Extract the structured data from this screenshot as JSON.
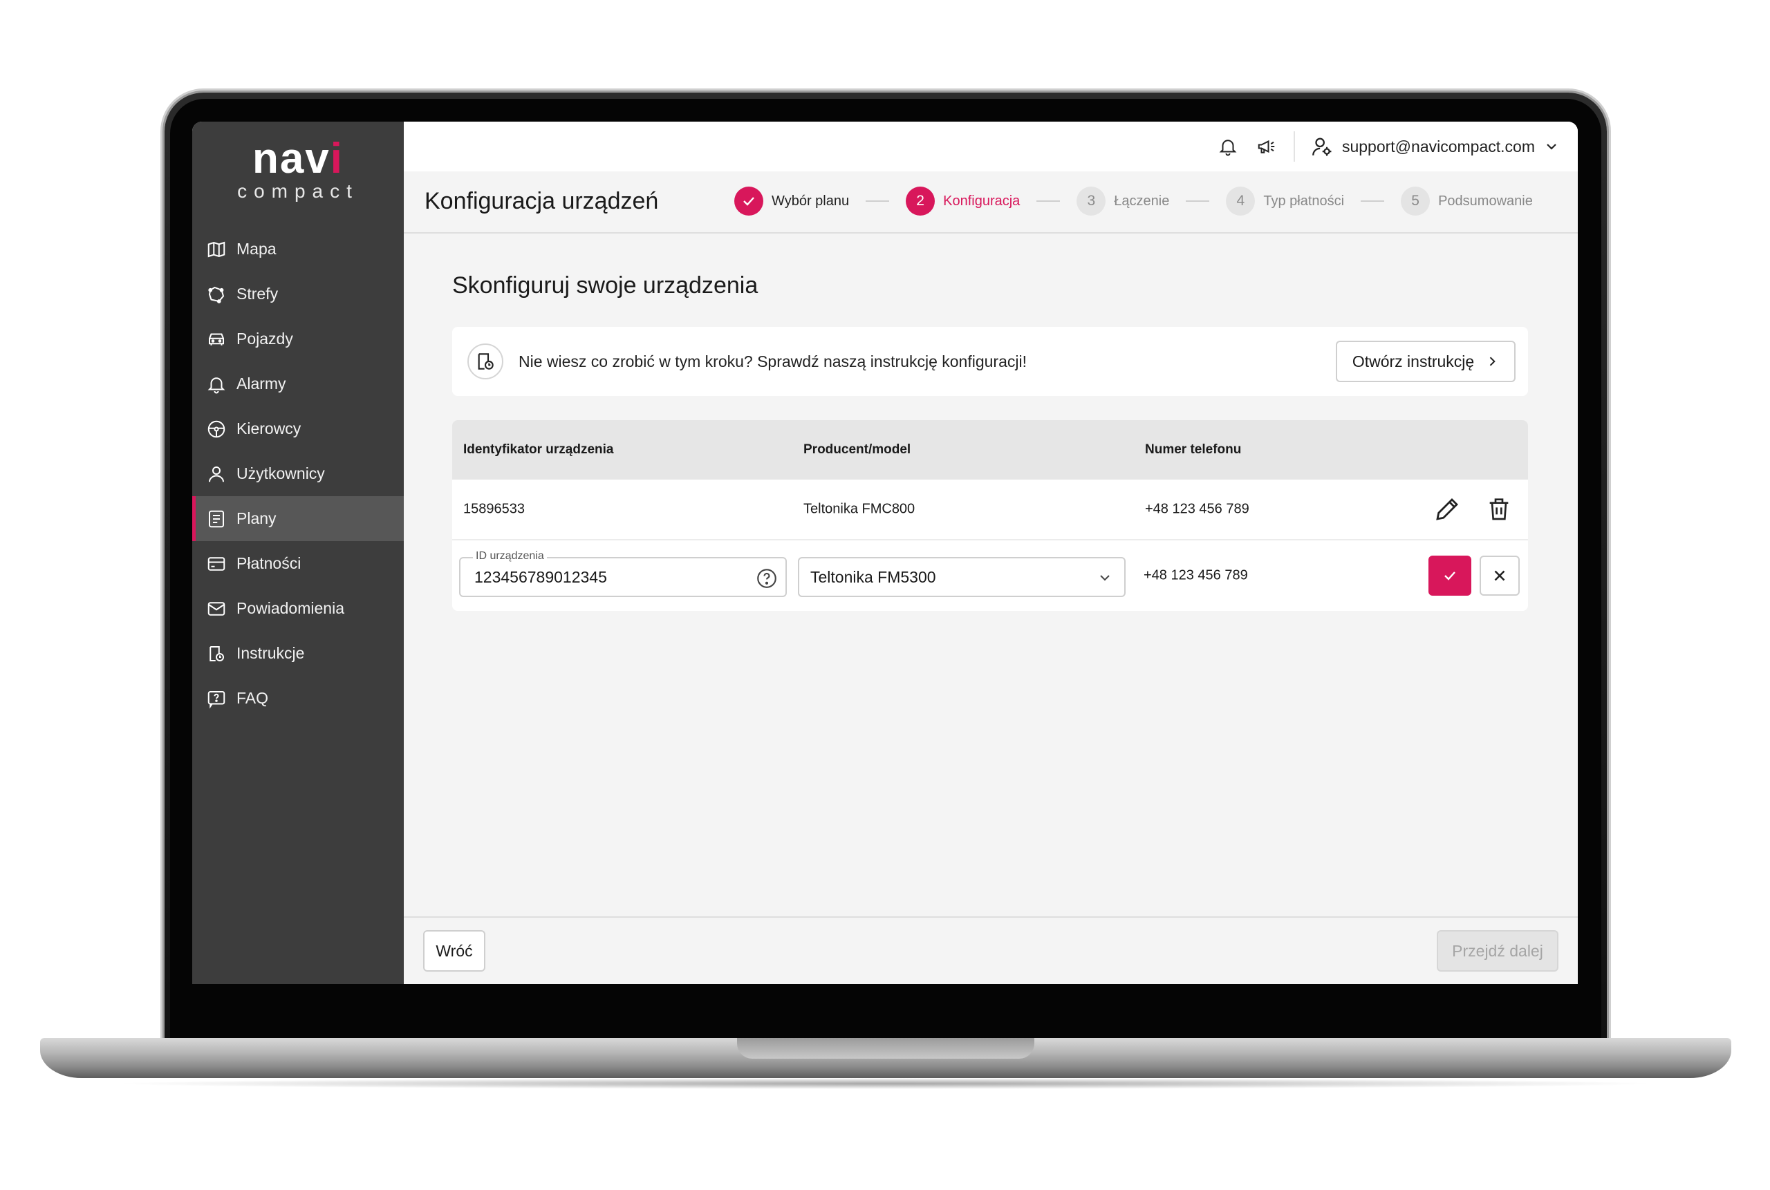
{
  "brand": {
    "logo_main_a": "nav",
    "logo_main_b": "i",
    "logo_sub": "compact",
    "accent": "#d8175b"
  },
  "sidebar": {
    "items": [
      {
        "label": "Mapa",
        "icon": "map-icon"
      },
      {
        "label": "Strefy",
        "icon": "zones-icon"
      },
      {
        "label": "Pojazdy",
        "icon": "car-icon"
      },
      {
        "label": "Alarmy",
        "icon": "bell-icon"
      },
      {
        "label": "Kierowcy",
        "icon": "steering-wheel-icon"
      },
      {
        "label": "Użytkownicy",
        "icon": "user-icon"
      },
      {
        "label": "Plany",
        "icon": "plans-icon",
        "active": true
      },
      {
        "label": "Płatności",
        "icon": "card-icon"
      },
      {
        "label": "Powiadomienia",
        "icon": "mail-icon"
      },
      {
        "label": "Instrukcje",
        "icon": "instructions-icon"
      },
      {
        "label": "FAQ",
        "icon": "faq-icon"
      }
    ]
  },
  "topbar": {
    "user_email": "support@navicompact.com"
  },
  "header": {
    "title": "Konfiguracja urządzeń",
    "steps": [
      {
        "number": "",
        "label": "Wybór planu",
        "state": "done"
      },
      {
        "number": "2",
        "label": "Konfiguracja",
        "state": "current"
      },
      {
        "number": "3",
        "label": "Łączenie",
        "state": "upcoming"
      },
      {
        "number": "4",
        "label": "Typ płatności",
        "state": "upcoming"
      },
      {
        "number": "5",
        "label": "Podsumowanie",
        "state": "upcoming"
      }
    ]
  },
  "main": {
    "title": "Skonfiguruj swoje urządzenia",
    "info_text": "Nie wiesz co zrobić w tym kroku? Sprawdź naszą instrukcję konfiguracji!",
    "info_button": "Otwórz instrukcję"
  },
  "table": {
    "headers": [
      "Identyfikator urządzenia",
      "Producent/model",
      "Numer telefonu"
    ],
    "rows": [
      {
        "id": "15896533",
        "model": "Teltonika FMC800",
        "phone": "+48 123 456 789"
      }
    ],
    "edit_row": {
      "id_label": "ID urządzenia",
      "id_value": "123456789012345",
      "model_value": "Teltonika FM5300",
      "phone": "+48 123 456 789"
    }
  },
  "footer": {
    "back_label": "Wróć",
    "next_label": "Przejdź dalej"
  }
}
